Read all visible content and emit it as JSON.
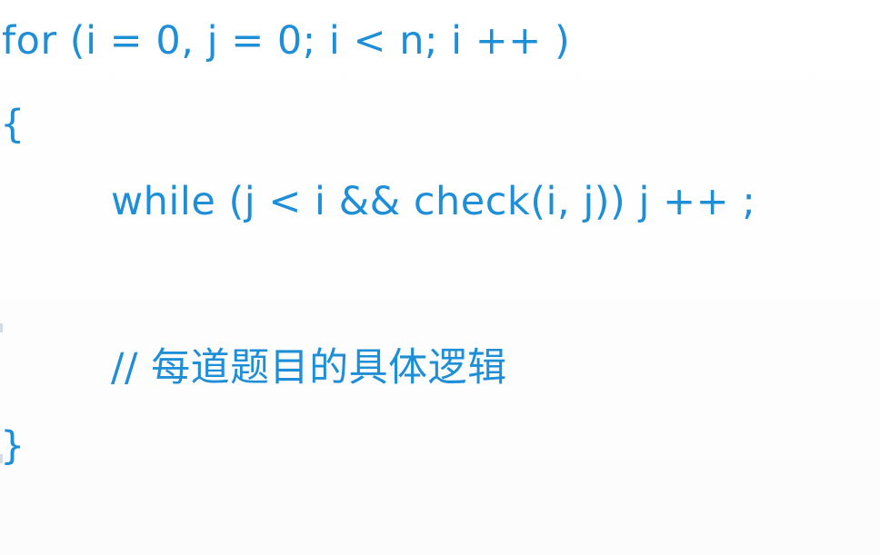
{
  "code": {
    "lines": [
      "for (i = 0, j = 0; i < n; i ++ )",
      "{",
      "while (j < i && check(i, j)) j ++ ;",
      "// 每道题目的具体逻辑",
      "}"
    ]
  },
  "colors": {
    "code_text": "#1e8fd6",
    "background": "#ffffff"
  }
}
